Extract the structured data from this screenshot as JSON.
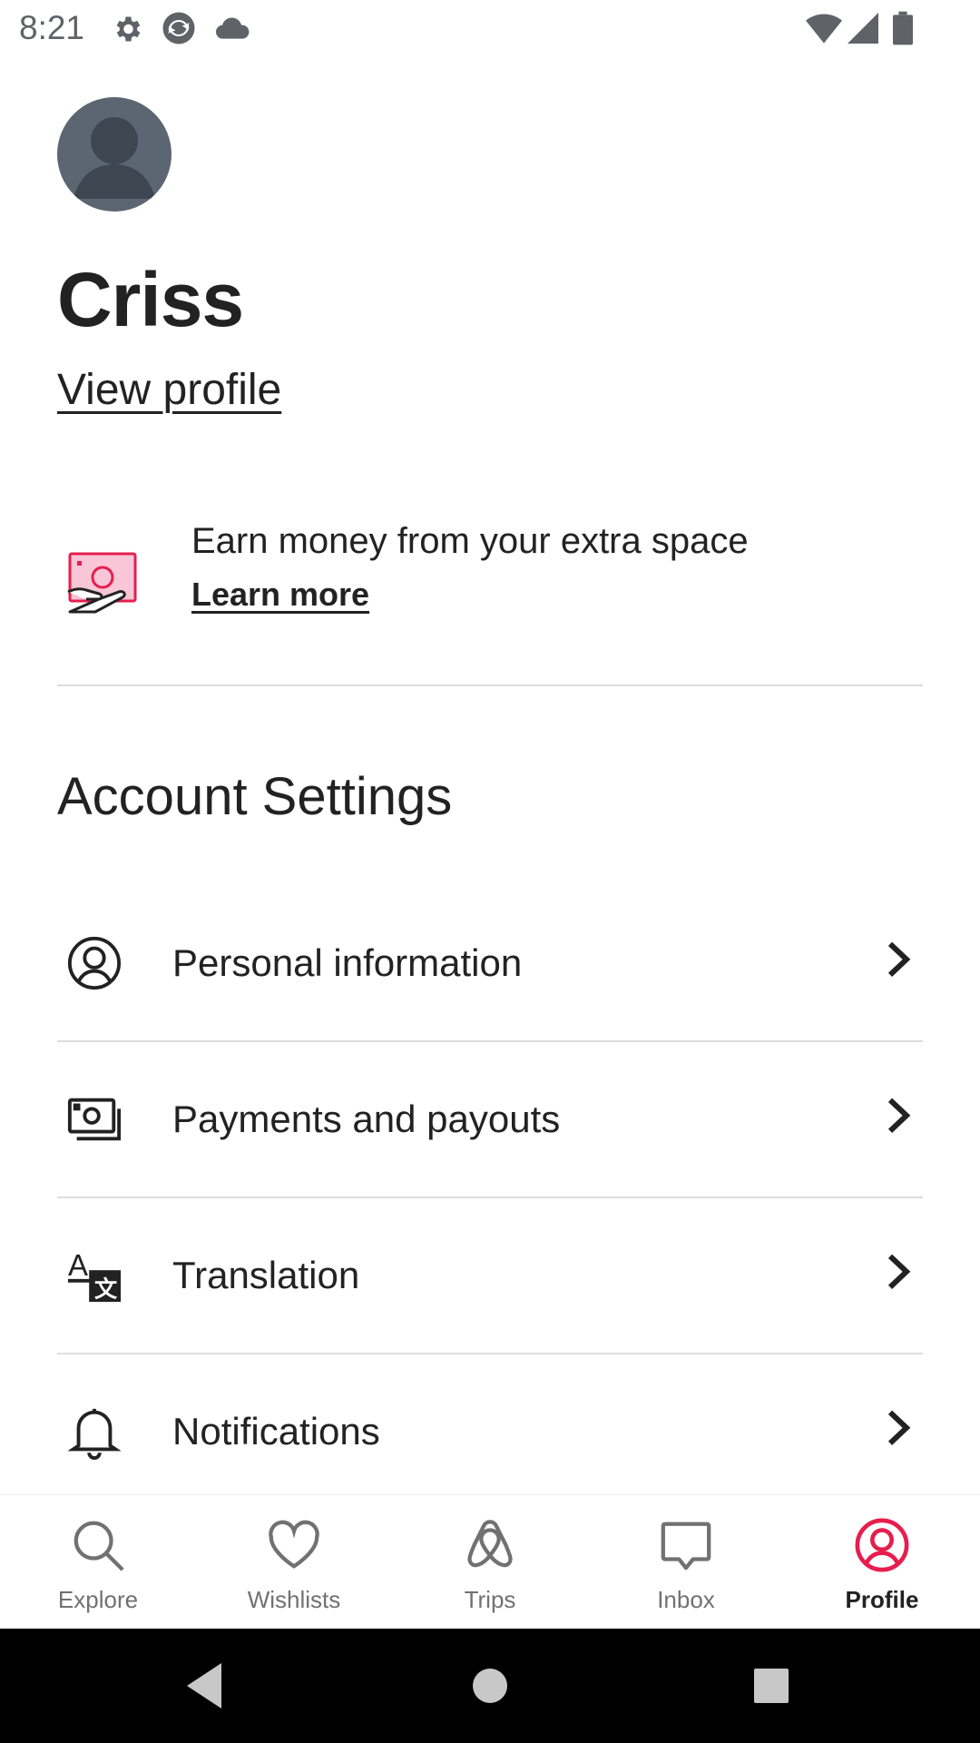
{
  "status_bar": {
    "time": "8:21",
    "left_icons": [
      "gear-icon",
      "sync-app-icon",
      "cloud-icon"
    ],
    "right_icons": [
      "wifi-icon",
      "cell-signal-icon",
      "battery-icon"
    ]
  },
  "profile": {
    "name": "Criss",
    "view_profile_label": "View profile"
  },
  "host_promo": {
    "icon": "cash-hand-icon",
    "title": "Earn money from your extra space",
    "link_label": "Learn more",
    "accent_color": "#E61E4D"
  },
  "account_settings": {
    "title": "Account Settings",
    "items": [
      {
        "label": "Personal information",
        "icon": "user-circle-icon"
      },
      {
        "label": "Payments and payouts",
        "icon": "payments-icon"
      },
      {
        "label": "Translation",
        "icon": "translate-icon"
      },
      {
        "label": "Notifications",
        "icon": "bell-icon"
      }
    ]
  },
  "bottom_nav": {
    "active_color": "#E61E4D",
    "items": [
      {
        "label": "Explore",
        "icon": "search-icon",
        "active": false
      },
      {
        "label": "Wishlists",
        "icon": "heart-icon",
        "active": false
      },
      {
        "label": "Trips",
        "icon": "airbnb-logo-icon",
        "active": false
      },
      {
        "label": "Inbox",
        "icon": "message-icon",
        "active": false
      },
      {
        "label": "Profile",
        "icon": "profile-icon",
        "active": true
      }
    ]
  },
  "system_nav": {
    "buttons": [
      "back-icon",
      "home-icon",
      "recents-icon"
    ]
  }
}
